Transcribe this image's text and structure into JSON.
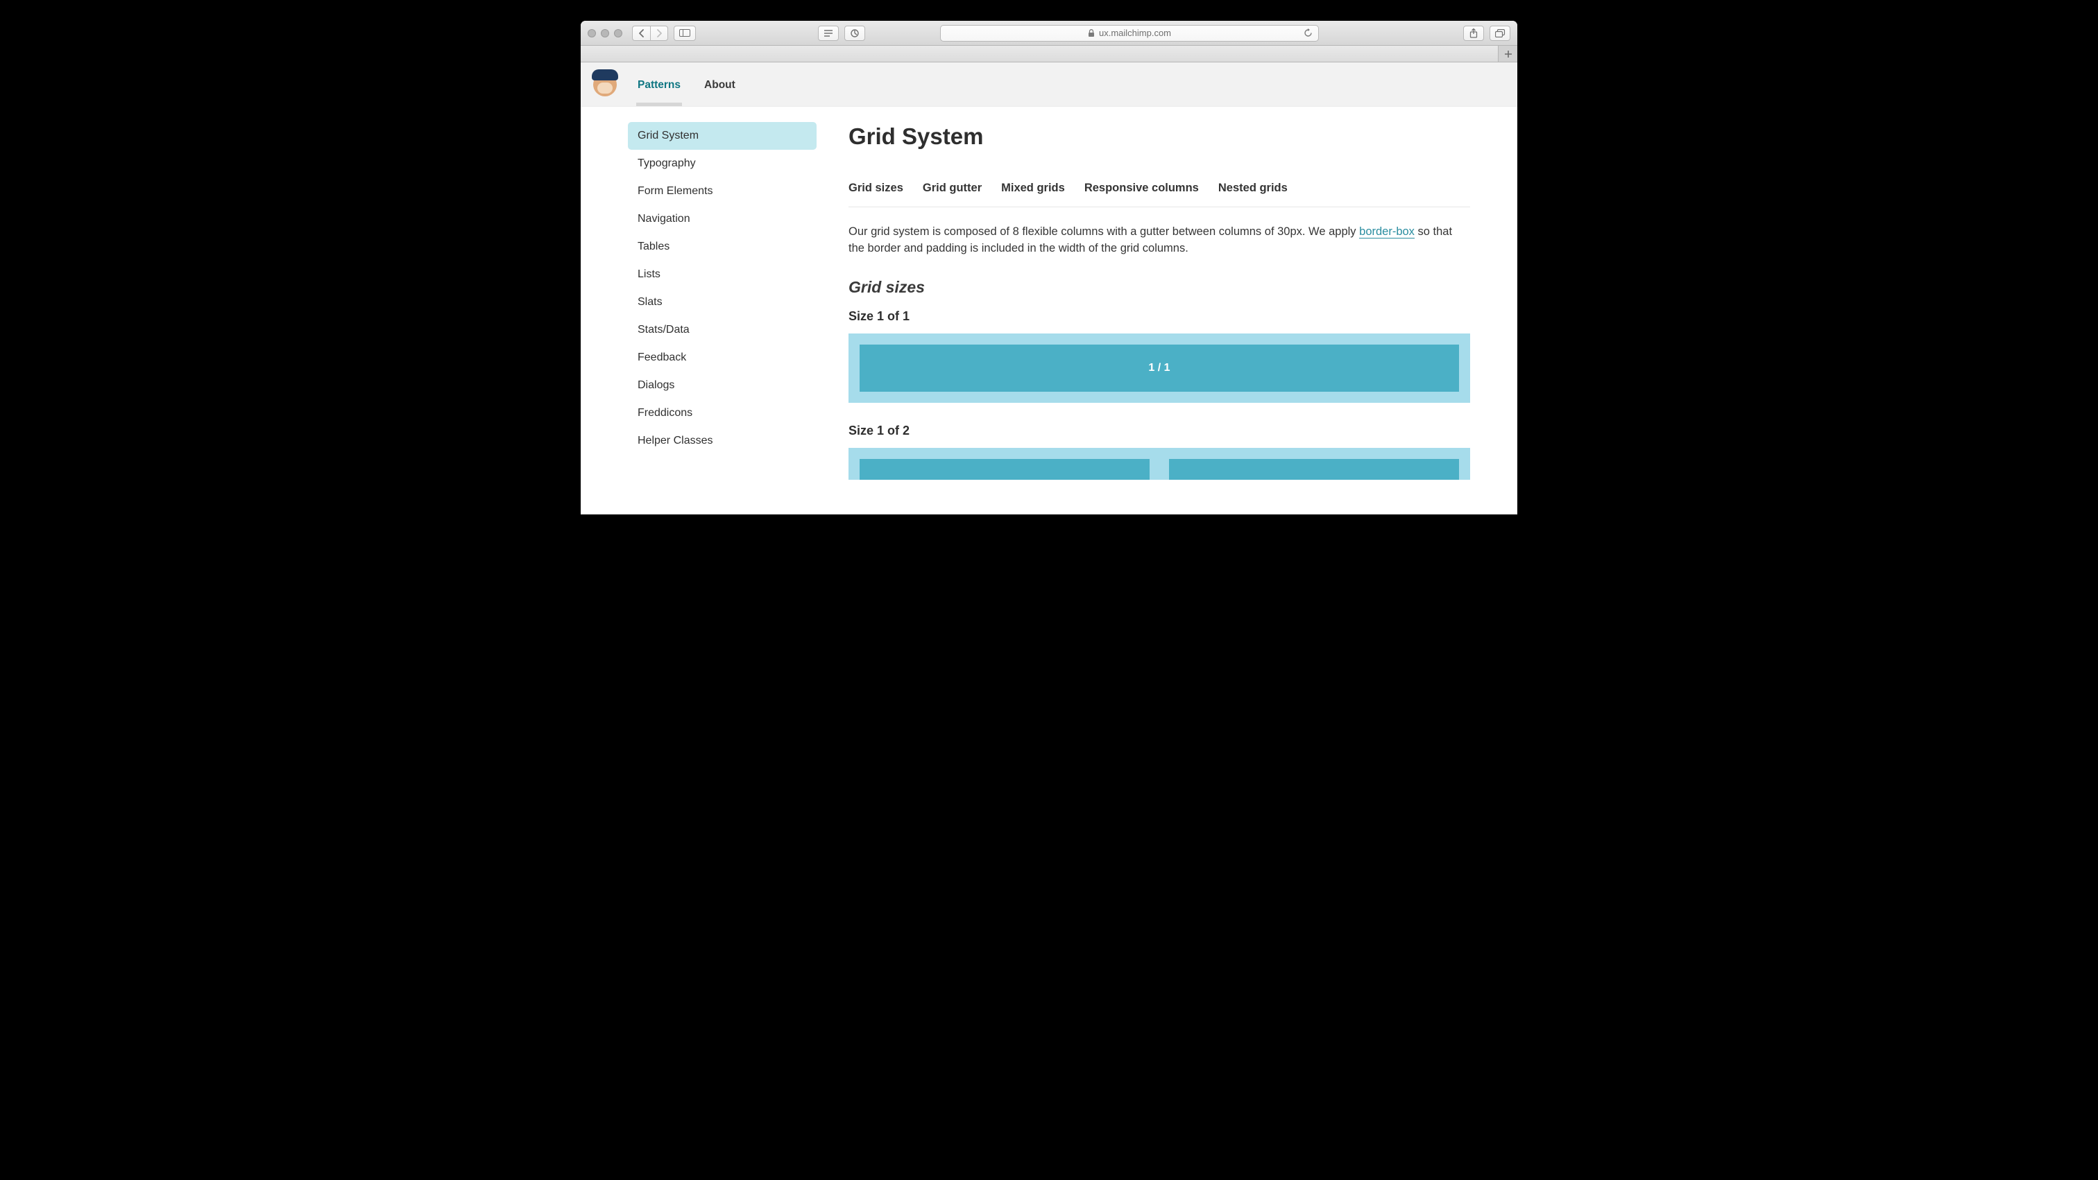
{
  "browser": {
    "url_host": "ux.mailchimp.com"
  },
  "header": {
    "nav": {
      "patterns": "Patterns",
      "about": "About"
    }
  },
  "sidebar": {
    "items": [
      "Grid System",
      "Typography",
      "Form Elements",
      "Navigation",
      "Tables",
      "Lists",
      "Slats",
      "Stats/Data",
      "Feedback",
      "Dialogs",
      "Freddicons",
      "Helper Classes"
    ],
    "active_index": 0
  },
  "main": {
    "title": "Grid System",
    "anchors": [
      "Grid sizes",
      "Grid gutter",
      "Mixed grids",
      "Responsive columns",
      "Nested grids"
    ],
    "intro_pre": "Our grid system is composed of 8 flexible columns with a gutter between columns of 30px. We apply ",
    "intro_link": "border-box",
    "intro_post": " so that the border and padding is included in the width of the grid columns.",
    "section_heading": "Grid sizes",
    "example1": {
      "title": "Size 1 of 1",
      "cell": "1 / 1"
    },
    "example2": {
      "title": "Size 1 of 2"
    }
  }
}
